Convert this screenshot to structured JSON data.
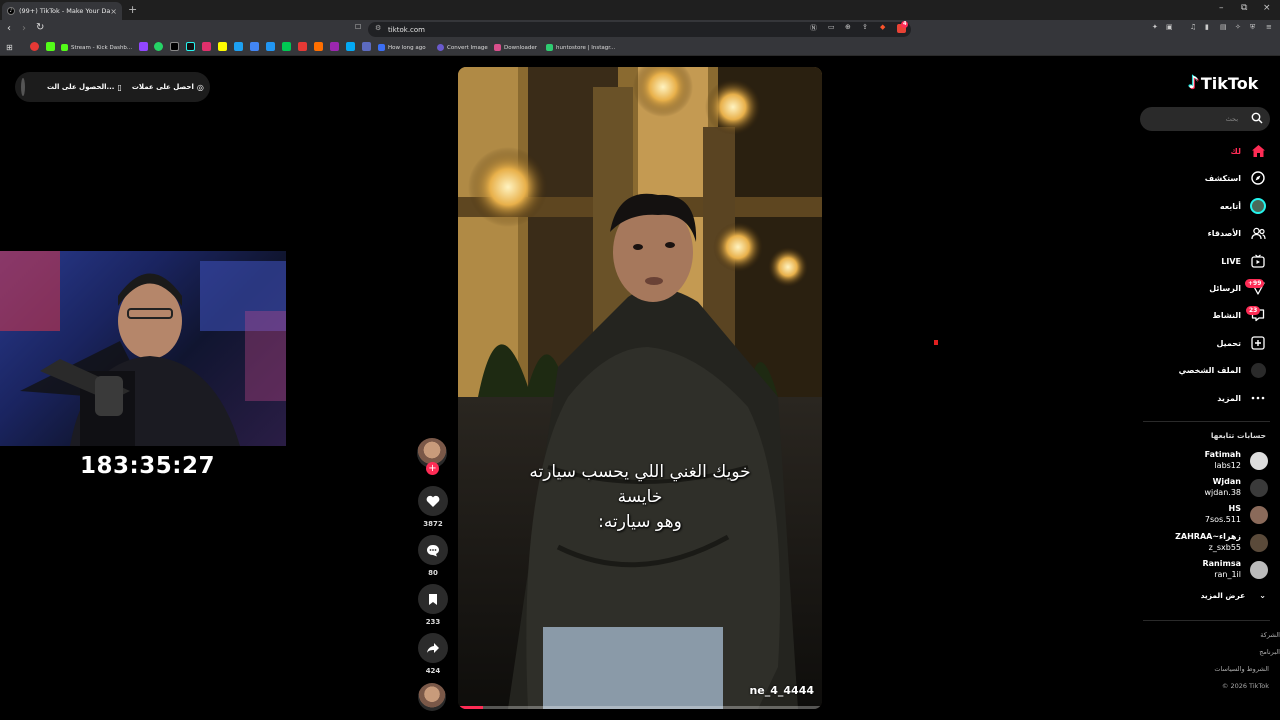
{
  "browser": {
    "tab_title": "(99+) TikTok - Make Your Day",
    "tab_close": "×",
    "new_tab": "+",
    "url": "tiktok.com",
    "window_controls": [
      "–",
      "⧉",
      "×"
    ],
    "bookmarks": [
      {
        "label": "Stream - Kick Dashb...",
        "color": "#53fc18"
      },
      {
        "label": "How long ago",
        "color": "#3b6ff5"
      },
      {
        "label": "Convert Image",
        "color": "#6a5acd"
      },
      {
        "label": "Downloader",
        "color": "#d94f8c"
      },
      {
        "label": "huntostore | Instagr...",
        "color": "#2ecc71"
      }
    ],
    "shield_badge": "4"
  },
  "overlay": {
    "coin_bar": {
      "item_1": "احصل على عملات",
      "item_2": "الحصول على الت..."
    },
    "timer": "183:35:27"
  },
  "video": {
    "caption_lines": [
      "خويك الغني اللي يحسب سيارته",
      "خايسة",
      "وهو سيارته:"
    ],
    "watermark": "ne_4_4444",
    "progress": 0.07
  },
  "actions": {
    "likes": "3872",
    "comments": "80",
    "saves": "233",
    "shares": "424"
  },
  "sidebar": {
    "logo": "TikTok",
    "search_placeholder": "بحث",
    "nav": [
      {
        "label": "لك",
        "icon": "home-icon",
        "active": true
      },
      {
        "label": "استكشف",
        "icon": "compass-icon"
      },
      {
        "label": "أتابعه",
        "icon": "following-avatar-icon"
      },
      {
        "label": "الأصدقاء",
        "icon": "friends-icon"
      },
      {
        "label": "LIVE",
        "icon": "live-icon"
      },
      {
        "label": "الرسائل",
        "icon": "messages-icon",
        "badge": "+99"
      },
      {
        "label": "النشاط",
        "icon": "activity-icon",
        "badge": "23"
      },
      {
        "label": "تحميل",
        "icon": "upload-icon"
      },
      {
        "label": "الملف الشخصي",
        "icon": "profile-icon"
      },
      {
        "label": "المزيد",
        "icon": "more-icon"
      }
    ],
    "following_title": "حسابات تتابعها",
    "following": [
      {
        "name": "Fatimah",
        "user": "labs12"
      },
      {
        "name": "Wjdan",
        "user": "wjdan.38"
      },
      {
        "name": "HS",
        "user": "7sos.511"
      },
      {
        "name": "ZAHRAA~زهراء",
        "user": "z_sxb55"
      },
      {
        "name": "Ranimsa",
        "user": "ran_1il"
      }
    ],
    "see_more": "عرض المزيد",
    "footer": [
      "الشركة",
      "البرنامج",
      "الشروط والسياسات",
      "© 2026 TikTok"
    ]
  },
  "colors": {
    "accent": "#fe2c55",
    "background": "#000000",
    "chrome": "#35363a"
  }
}
